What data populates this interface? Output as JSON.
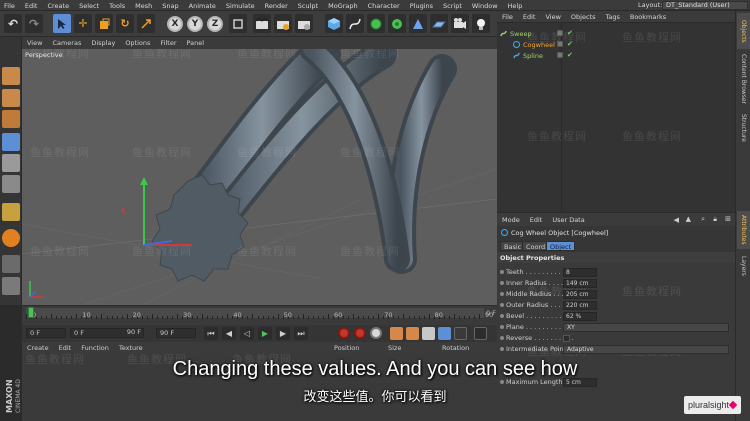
{
  "menubar": {
    "items": [
      "File",
      "Edit",
      "Create",
      "Select",
      "Tools",
      "Mesh",
      "Snap",
      "Animate",
      "Simulate",
      "Render",
      "Sculpt",
      "MoGraph",
      "Character",
      "Plugins",
      "Script",
      "Window",
      "Help"
    ],
    "layout_label": "Layout:",
    "layout_value": "DT_Standard (User)"
  },
  "viewport": {
    "menu": [
      "View",
      "Cameras",
      "Display",
      "Options",
      "Filter",
      "Panel"
    ],
    "label": "Perspective",
    "watermark": "鱼鱼教程网"
  },
  "timeline": {
    "ticks": [
      "0",
      "10",
      "20",
      "30",
      "40",
      "50",
      "60",
      "70",
      "80",
      "90"
    ],
    "end_label": "0 F",
    "current_frame": 0
  },
  "transport": {
    "start": "0 F",
    "min_preview": "0 F",
    "max_preview": "90 F",
    "end": "90 F"
  },
  "material_manager": {
    "menu": [
      "Create",
      "Edit",
      "Function",
      "Texture"
    ]
  },
  "coordinates": {
    "headers": [
      "Position",
      "Size",
      "Rotation"
    ]
  },
  "object_manager": {
    "menu": [
      "File",
      "Edit",
      "View",
      "Objects",
      "Tags",
      "Bookmarks"
    ],
    "objects": [
      {
        "name": "Sweep",
        "color": "#9fd36a",
        "indent": 0
      },
      {
        "name": "Cogwheel",
        "color": "#f0a83a",
        "indent": 1
      },
      {
        "name": "Spline",
        "color": "#9fd36a",
        "indent": 1
      }
    ]
  },
  "right_tabs": [
    "Objects",
    "Content Browser",
    "Structure",
    "Attributes",
    "Layers"
  ],
  "attribute_manager": {
    "menu": [
      "Mode",
      "Edit",
      "User Data"
    ],
    "title": "Cog Wheel Object [Cogwheel]",
    "tabs": [
      "Basic",
      "Coord.",
      "Object"
    ],
    "active_tab": "Object",
    "section": "Object Properties",
    "properties": [
      {
        "label": "Teeth . . . . . . . . . . .",
        "value": "8",
        "kind": "field"
      },
      {
        "label": "Inner Radius . . . . . .",
        "value": "149 cm",
        "kind": "field"
      },
      {
        "label": "Middle Radius . . . . .",
        "value": "205 cm",
        "kind": "field"
      },
      {
        "label": "Outer Radius . . . . . .",
        "value": "220 cm",
        "kind": "field"
      },
      {
        "label": "Bevel . . . . . . . . . . . .",
        "value": "62 %",
        "kind": "field"
      },
      {
        "label": "Plane . . . . . . . . . . .",
        "value": "XY",
        "kind": "select"
      },
      {
        "label": "Reverse . . . . . . . . . .",
        "value": "",
        "kind": "check"
      },
      {
        "label": "Intermediate Points",
        "value": "Adaptive",
        "kind": "select"
      },
      {
        "label": "",
        "value": "",
        "kind": "blank"
      },
      {
        "label": "",
        "value": "",
        "kind": "blank"
      },
      {
        "label": "Maximum Length . . .",
        "value": "5 cm",
        "kind": "field"
      }
    ]
  },
  "subtitles": {
    "english": "Changing these values. And you can see how",
    "chinese": "改变这些值。你可以看到"
  },
  "badge": {
    "text": "pluralsight"
  },
  "colors": {
    "accent": "#5d8fd6",
    "viewport_bg": "#5e5e5e",
    "panel_bg": "#3a3a3a"
  }
}
